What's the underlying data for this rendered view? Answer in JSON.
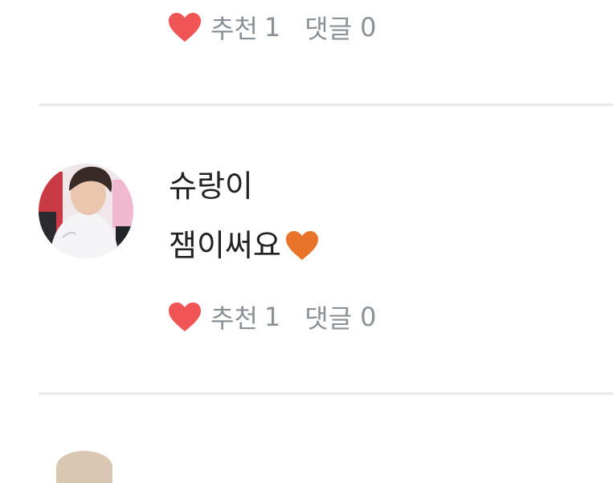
{
  "comments": [
    {
      "author": "",
      "text": "",
      "like_label": "추천",
      "like_count": "1",
      "reply_label": "댓글",
      "reply_count": "0",
      "heart_icon": "heart-icon"
    },
    {
      "author": "슈랑이",
      "text": "잼이써요",
      "text_emoji": "orange-heart-emoji",
      "like_label": "추천",
      "like_count": "1",
      "reply_label": "댓글",
      "reply_count": "0",
      "heart_icon": "heart-icon"
    }
  ],
  "colors": {
    "heart": "#f05454",
    "orange_heart": "#e8742a",
    "meta_text": "#8a9196",
    "divider": "#e5eaea"
  }
}
